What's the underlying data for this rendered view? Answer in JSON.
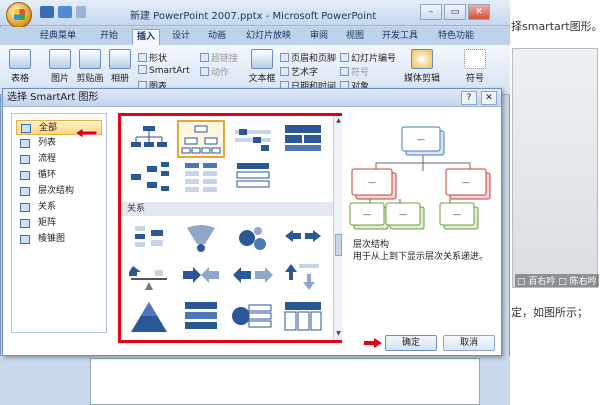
{
  "window": {
    "title": "新建 PowerPoint 2007.pptx - Microsoft PowerPoint",
    "min_glyph": "–",
    "max_glyph": "▭",
    "close_glyph": "✕"
  },
  "tabs": [
    "经典菜单",
    "开始",
    "插入",
    "设计",
    "动画",
    "幻灯片放映",
    "审阅",
    "视图",
    "开发工具",
    "特色功能"
  ],
  "active_tab_index": 2,
  "ribbon": {
    "table": "表格",
    "picture": "图片",
    "clipart": "剪贴画",
    "album": "相册",
    "shapes": "形状",
    "smartart": "SmartArt",
    "chart": "图表",
    "hyperlink": "超链接",
    "action": "动作",
    "textbox": "文本框",
    "header_footer": "页眉和页脚",
    "wordart": "艺术字",
    "datetime": "日期和时间",
    "slide_number": "幻灯片编号",
    "symbol": "符号",
    "object": "对象",
    "media": "媒体剪辑",
    "special": "符号"
  },
  "dialog": {
    "title": "选择 SmartArt 图形",
    "help": "?",
    "close": "✕",
    "categories": [
      "全部",
      "列表",
      "流程",
      "循环",
      "层次结构",
      "关系",
      "矩阵",
      "棱锥图"
    ],
    "selected_category": 0,
    "gallery_section": "关系",
    "preview_name": "层次结构",
    "preview_desc": "用于从上到下显示层次关系递进。",
    "ok": "确定",
    "cancel": "取消"
  },
  "right_panel": {
    "text_top": "择smartart图形。",
    "text_bottom": "定，如图所示；",
    "watermark": "□ 百右吟 □ 陈右吟"
  },
  "colors": {
    "highlight_red": "#e00018",
    "accent_blue": "#2b5797",
    "ribbon_bg": "#d6e3f3"
  }
}
